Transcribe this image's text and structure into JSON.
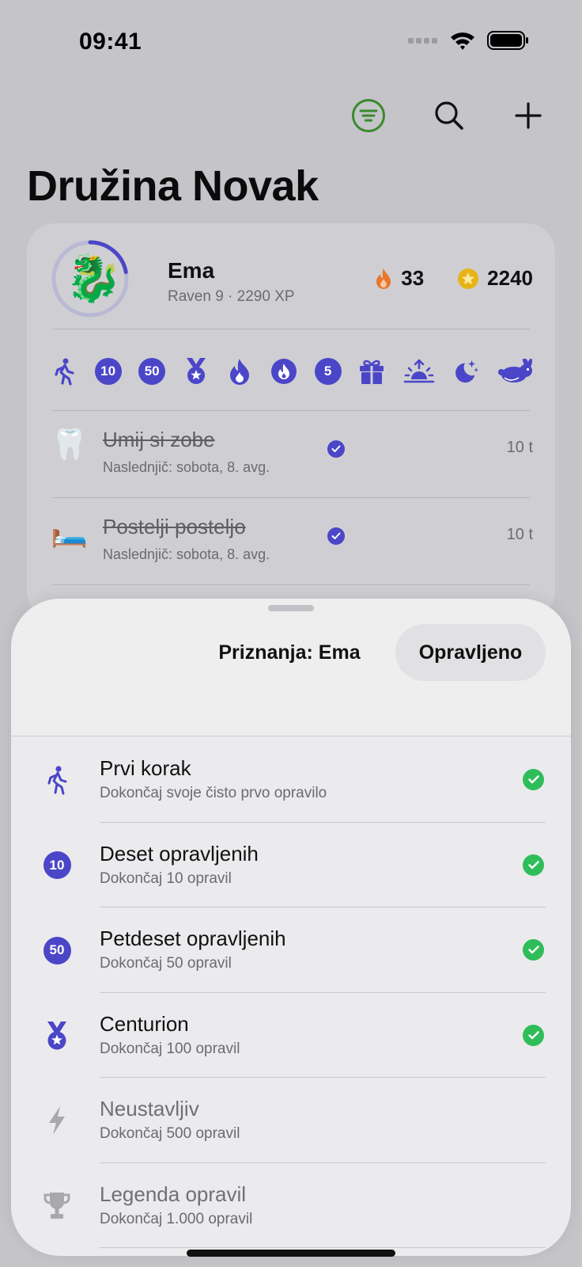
{
  "status_bar": {
    "time": "09:41"
  },
  "page": {
    "title": "Družina Novak"
  },
  "member": {
    "name": "Ema",
    "subtitle": "Raven 9 · 2290 XP",
    "avatar_emoji": "🐉",
    "streak": "33",
    "coins": "2240",
    "level_progress": 0.22
  },
  "badges": [
    {
      "icon": "walking-person-icon"
    },
    {
      "icon": "number-badge",
      "label": "10"
    },
    {
      "icon": "number-badge",
      "label": "50"
    },
    {
      "icon": "medal-icon"
    },
    {
      "icon": "flame-icon"
    },
    {
      "icon": "flame-circle-icon"
    },
    {
      "icon": "number-badge",
      "label": "5"
    },
    {
      "icon": "gift-icon"
    },
    {
      "icon": "sunrise-icon"
    },
    {
      "icon": "moon-stars-icon"
    },
    {
      "icon": "rabbit-icon"
    }
  ],
  "chores": [
    {
      "emoji": "🦷",
      "title": "Umij si zobe",
      "next": "Naslednjič: sobota, 8. avg.",
      "points": "10 t"
    },
    {
      "emoji": "🛏️",
      "title": "Postelji posteljo",
      "next": "Naslednjič: sobota, 8. avg.",
      "points": "10 t"
    }
  ],
  "sheet": {
    "title": "Priznanja: Ema",
    "done_label": "Opravljeno",
    "achievements": [
      {
        "icon": "walking-person-icon",
        "title": "Prvi korak",
        "description": "Dokončaj svoje čisto prvo opravilo",
        "unlocked": true
      },
      {
        "icon": "number-badge",
        "badge_label": "10",
        "title": "Deset opravljenih",
        "description": "Dokončaj 10 opravil",
        "unlocked": true
      },
      {
        "icon": "number-badge",
        "badge_label": "50",
        "title": "Petdeset opravljenih",
        "description": "Dokončaj 50 opravil",
        "unlocked": true
      },
      {
        "icon": "medal-icon",
        "title": "Centurion",
        "description": "Dokončaj 100 opravil",
        "unlocked": true
      },
      {
        "icon": "bolt-icon",
        "title": "Neustavljiv",
        "description": "Dokončaj 500 opravil",
        "unlocked": false
      },
      {
        "icon": "trophy-icon",
        "title": "Legenda opravil",
        "description": "Dokončaj 1.000 opravil",
        "unlocked": false
      }
    ]
  },
  "colors": {
    "accent": "#4b46c8",
    "success": "#2fbd5a",
    "streak": "#e8772e",
    "coin": "#e6b417",
    "filter_active": "#3a8a2e"
  }
}
